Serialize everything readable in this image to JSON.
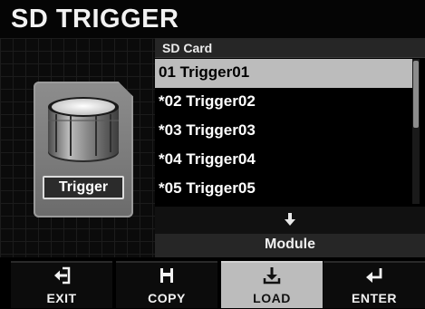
{
  "title": "SD TRIGGER",
  "card": {
    "label": "Trigger",
    "icon": "drum-icon"
  },
  "list": {
    "header": "SD Card",
    "items": [
      {
        "label": "01 Trigger01",
        "selected": true
      },
      {
        "label": "*02 Trigger02",
        "selected": false
      },
      {
        "label": "*03 Trigger03",
        "selected": false
      },
      {
        "label": "*04 Trigger04",
        "selected": false
      },
      {
        "label": "*05 Trigger05",
        "selected": false
      }
    ]
  },
  "arrow_icon": "arrow-down-icon",
  "destination": "Module",
  "footer": [
    {
      "label": "EXIT",
      "icon": "exit-icon",
      "active": false
    },
    {
      "label": "COPY",
      "icon": "save-icon",
      "active": false
    },
    {
      "label": "LOAD",
      "icon": "download-icon",
      "active": true
    },
    {
      "label": "ENTER",
      "icon": "enter-icon",
      "active": false
    }
  ],
  "colors": {
    "background": "#000000",
    "highlight": "#bcbcbc",
    "header_bar": "#262626"
  }
}
